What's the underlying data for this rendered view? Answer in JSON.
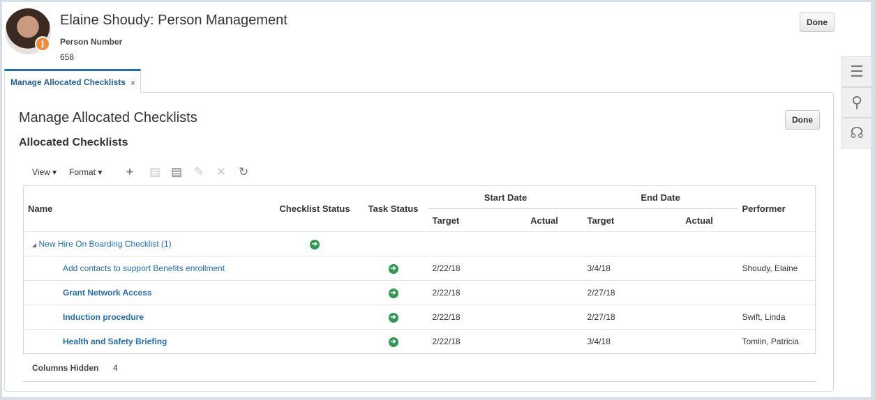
{
  "header": {
    "title": "Elaine Shoudy: Person Management",
    "person_number_label": "Person Number",
    "person_number": "658",
    "done": "Done"
  },
  "tab": {
    "label": "Manage Allocated Checklists",
    "close": "×"
  },
  "main": {
    "title": "Manage Allocated Checklists",
    "subtitle": "Allocated Checklists",
    "done": "Done"
  },
  "toolbar": {
    "view": "View ▾",
    "format": "Format ▾"
  },
  "table": {
    "headers": {
      "name": "Name",
      "checklist_status": "Checklist Status",
      "task_status": "Task Status",
      "start_date": "Start Date",
      "end_date": "End Date",
      "target": "Target",
      "actual": "Actual",
      "performer": "Performer"
    },
    "group": {
      "name": "New Hire On Boarding Checklist (1)"
    },
    "rows": [
      {
        "name": "Add contacts to support Benefits enrollment",
        "start_target": "2/22/18",
        "end_target": "3/4/18",
        "performer": "Shoudy, Elaine"
      },
      {
        "name": "Grant Network Access",
        "start_target": "2/22/18",
        "end_target": "2/27/18",
        "performer": ""
      },
      {
        "name": "Induction procedure",
        "start_target": "2/22/18",
        "end_target": "2/27/18",
        "performer": "Swift, Linda"
      },
      {
        "name": "Health and Safety Briefing",
        "start_target": "2/22/18",
        "end_target": "3/4/18",
        "performer": "Tomlin, Patricia"
      }
    ]
  },
  "footer": {
    "columns_hidden_label": "Columns Hidden",
    "columns_hidden": "4"
  }
}
